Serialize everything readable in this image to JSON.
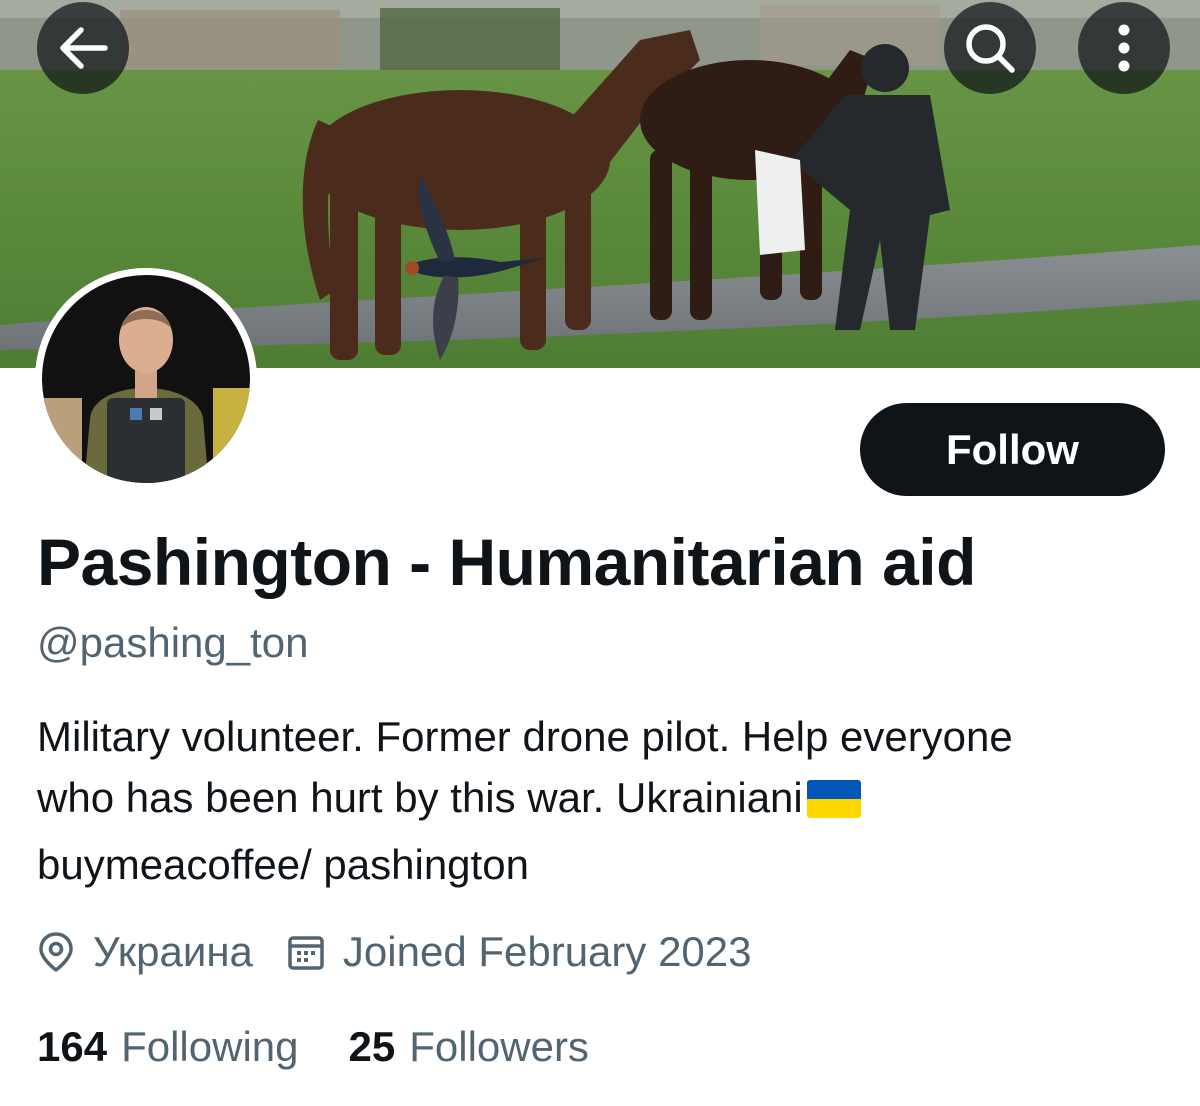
{
  "header": {
    "back_icon": "arrow-left-icon",
    "search_icon": "search-icon",
    "more_icon": "more-vertical-icon"
  },
  "profile": {
    "display_name": "Pashington - Humanitarian aid",
    "handle": "@pashing_ton",
    "bio_lines": [
      "Military volunteer. Former drone pilot. Help everyone",
      "who has been hurt by this war. Ukrainiani",
      "buymeacoffee/ pashington"
    ],
    "bio_flag_icon": "ukraine-flag-icon",
    "location": "Украина",
    "location_icon": "location-pin-icon",
    "joined": "Joined February 2023",
    "joined_icon": "calendar-icon",
    "following_count": "164",
    "following_label": "Following",
    "followers_count": "25",
    "followers_label": "Followers"
  },
  "actions": {
    "follow_label": "Follow"
  },
  "colors": {
    "text_primary": "#0f1419",
    "text_secondary": "#536471",
    "button_dark": "#0f1419",
    "flag_blue": "#0057b7",
    "flag_yellow": "#ffd700"
  }
}
